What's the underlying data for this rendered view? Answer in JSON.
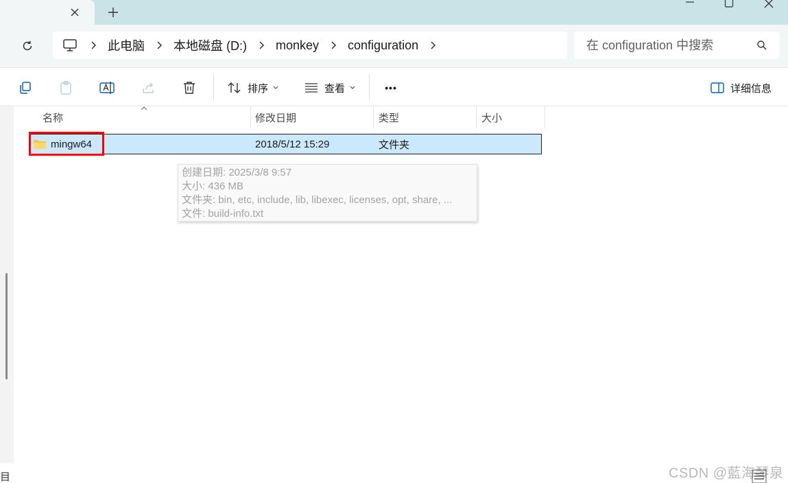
{
  "tab": {
    "new_tab_symbol": "+"
  },
  "address": {
    "crumbs": [
      "此电脑",
      "本地磁盘 (D:)",
      "monkey",
      "configuration"
    ]
  },
  "search": {
    "placeholder": "在 configuration 中搜索"
  },
  "toolbar": {
    "sort_label": "排序",
    "view_label": "查看",
    "more_label": "•••",
    "details_label": "详细信息"
  },
  "columns": {
    "name": "名称",
    "modified": "修改日期",
    "type": "类型",
    "size": "大小"
  },
  "files": [
    {
      "name": "mingw64",
      "modified": "2018/5/12 15:29",
      "type": "文件夹",
      "size": ""
    }
  ],
  "tooltip": {
    "created": "创建日期: 2025/3/8 9:57",
    "size": "大小: 436 MB",
    "folders": "文件夹: bin, etc, include, lib, libexec, licenses, opt, share, ...",
    "file": "文件: build-info.txt"
  },
  "status": {
    "items_fragment": "目"
  },
  "watermark": "CSDN @藍海琴泉",
  "colors": {
    "titlebar": "#c9e3e7",
    "selection": "#cce8ff",
    "highlight_box": "#ff0000",
    "accent": "#005fb8"
  }
}
